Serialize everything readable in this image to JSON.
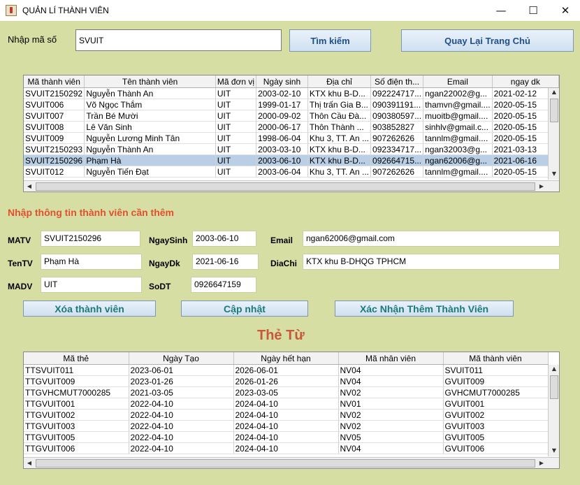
{
  "window": {
    "title": "QUẢN LÍ THÀNH VIÊN",
    "minimize": "—",
    "maximize": "☐",
    "close": "✕"
  },
  "search": {
    "label": "Nhập mã số",
    "value": "SVUIT",
    "button": "Tìm kiếm",
    "home_button": "Quay Lại Trang Chủ"
  },
  "members_table": {
    "columns": [
      "Mã thành viên",
      "Tên thành viên",
      "Mã đơn vị",
      "Ngày sinh",
      "Địa chỉ",
      "Số điện th...",
      "Email",
      "ngay dk"
    ],
    "rows": [
      [
        "SVUIT2150292",
        "Nguyễn Thành An",
        "UIT",
        "2003-02-10",
        "KTX khu B-D...",
        "092224717...",
        "ngan22002@g...",
        "2021-02-12"
      ],
      [
        "SVUIT006",
        "Võ Ngọc Thắm",
        "UIT",
        "1999-01-17",
        "Thị trấn Gia B...",
        "090391191...",
        "thamvn@gmail....",
        "2020-05-15"
      ],
      [
        "SVUIT007",
        "Trần Bé Mười",
        "UIT",
        "2000-09-02",
        "Thôn Cầu Đà...",
        "090380597...",
        "muoitb@gmail....",
        "2020-05-15"
      ],
      [
        "SVUIT008",
        "Lê Văn Sinh",
        "UIT",
        "2000-06-17",
        "Thôn Thành ...",
        "903852827",
        "sinhlv@gmail.c...",
        "2020-05-15"
      ],
      [
        "SVUIT009",
        "Nguyễn Lương Minh Tân",
        "UIT",
        "1998-06-04",
        "Khu 3, TT. An ...",
        "907262626",
        "tannlm@gmail....",
        "2020-05-15"
      ],
      [
        "SVUIT2150293",
        "Nguyễn Thành An",
        "UIT",
        "2003-03-10",
        "KTX khu B-D...",
        "092334717...",
        "ngan32003@g...",
        "2021-03-13"
      ],
      [
        "SVUIT2150296",
        "Phạm Hà",
        "UIT",
        "2003-06-10",
        "KTX khu B-D...",
        "092664715...",
        "ngan62006@g...",
        "2021-06-16"
      ],
      [
        "SVUIT012",
        "Nguyễn Tiến Đạt",
        "UIT",
        "2003-06-04",
        "Khu 3, TT. An ...",
        "907262626",
        "tannlm@gmail....",
        "2020-05-15"
      ]
    ],
    "selected_row": 6
  },
  "form": {
    "heading": "Nhập thông tin thành viên cần thêm",
    "matv_label": "MATV",
    "matv": "SVUIT2150296",
    "tentv_label": "TenTV",
    "tentv": "Phạm Hà",
    "madv_label": "MADV",
    "madv": "UIT",
    "ngaysinh_label": "NgaySinh",
    "ngaysinh": "2003-06-10",
    "ngaydk_label": "NgayDk",
    "ngaydk": "2021-06-16",
    "sodt_label": "SoDT",
    "sodt": "0926647159",
    "email_label": "Email",
    "email": "ngan62006@gmail.com",
    "diachi_label": "DiaChi",
    "diachi": "KTX khu B-DHQG TPHCM",
    "delete_button": "Xóa thành viên",
    "update_button": "Cập nhật",
    "add_button": "Xác Nhận Thêm Thành Viên"
  },
  "cards": {
    "heading": "Thẻ Từ",
    "columns": [
      "Mã thẻ",
      "Ngày Tạo",
      "Ngày hết hạn",
      "Mã nhân viên",
      "Mã thành viên"
    ],
    "rows": [
      [
        "TTSVUIT011",
        "2023-06-01",
        "2026-06-01",
        "NV04",
        "SVUIT011"
      ],
      [
        "TTGVUIT009",
        "2023-01-26",
        "2026-01-26",
        "NV04",
        "GVUIT009"
      ],
      [
        "TTGVHCMUT7000285",
        "2021-03-05",
        "2023-03-05",
        "NV02",
        "GVHCMUT7000285"
      ],
      [
        "TTGVUIT001",
        "2022-04-10",
        "2024-04-10",
        "NV01",
        "GVUIT001"
      ],
      [
        "TTGVUIT002",
        "2022-04-10",
        "2024-04-10",
        "NV02",
        "GVUIT002"
      ],
      [
        "TTGVUIT003",
        "2022-04-10",
        "2024-04-10",
        "NV02",
        "GVUIT003"
      ],
      [
        "TTGVUIT005",
        "2022-04-10",
        "2024-04-10",
        "NV05",
        "GVUIT005"
      ],
      [
        "TTGVUIT006",
        "2022-04-10",
        "2024-04-10",
        "NV04",
        "GVUIT006"
      ]
    ]
  }
}
